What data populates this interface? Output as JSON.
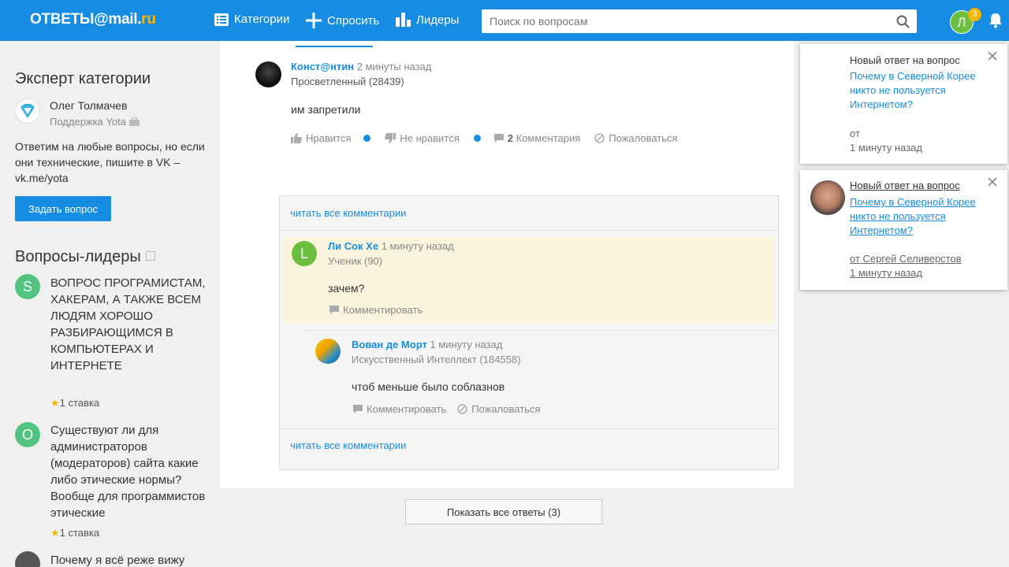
{
  "header": {
    "logo_main": "ОТВЕТЫ@mail.",
    "logo_ru": "ru",
    "nav": {
      "categories": "Категории",
      "ask": "Спросить",
      "leaders": "Лидеры"
    },
    "search_placeholder": "Поиск по вопросам",
    "user_initial": "Л",
    "notification_count": "3"
  },
  "sidebar": {
    "expert_title": "Эксперт категории",
    "expert_name": "Олег Толмачев",
    "expert_org": "Поддержка Yota",
    "expert_desc": "Ответим на любые вопросы, но если они технические, пишите в VK – vk.me/yota",
    "ask_button": "Задать вопрос",
    "leaders_title": "Вопросы-лидеры",
    "leader_questions": [
      {
        "initial": "S",
        "color": "#52c47f",
        "text": "ВОПРОС ПРОГРАМИСТАМ, ХАКЕРАМ, А ТАКЖЕ ВСЕМ ЛЮДЯМ ХОРОШО РАЗБИРАЮЩИМСЯ В КОМПЬЮТЕРАХ И ИНТЕРНЕТЕ",
        "bets": "1 ставка"
      },
      {
        "initial": "O",
        "color": "#52c47f",
        "text": "Существуют ли для администраторов (модераторов) сайта какие либо этические нормы? Вообще для программистов этические",
        "bets": "1 ставка"
      },
      {
        "initial": "",
        "color": "#555555",
        "text": "Почему я всё реже вижу",
        "bets": ""
      }
    ]
  },
  "answer": {
    "author": "Конст@нтин",
    "time": "2 минуты назад",
    "rank": "Просветленный (28439)",
    "text": "им запретили",
    "like": "Нравится",
    "dislike": "Не нравится",
    "comments_count": "2",
    "comments_label": "Комментария",
    "report": "Пожаловаться"
  },
  "comments": {
    "read_all": "читать все комментарии",
    "items": [
      {
        "initial": "L",
        "author": "Ли Сок Хе",
        "time": "1 минуту назад",
        "rank": "Ученик (90)",
        "text": "зачем?",
        "comment": "Комментировать"
      },
      {
        "author": "Вован де Морт",
        "time": "1 минуту назад",
        "rank": "Искусственный Интеллект (184558)",
        "text": "чтоб меньше было соблазнов",
        "comment": "Комментировать",
        "report": "Пожаловаться"
      }
    ]
  },
  "show_all_button": "Показать все ответы (3)",
  "notifications": [
    {
      "title": "Новый ответ на вопрос",
      "question": "Почему в Северной Корее никто не пользуется Интернетом?",
      "from": "от",
      "time": "1 минуту назад"
    },
    {
      "title": "Новый ответ на вопрос",
      "question": "Почему в Северной Корее никто не пользуется Интернетом?",
      "from": "от Сергей Селиверстов",
      "time": "1 минуту назад"
    }
  ]
}
